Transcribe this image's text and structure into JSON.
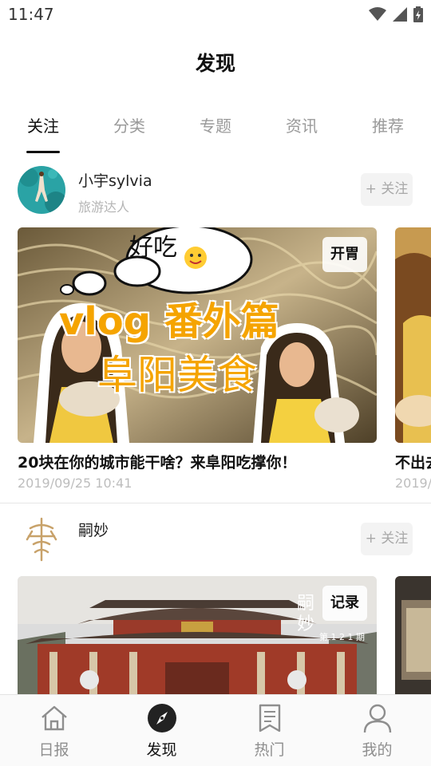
{
  "status_bar": {
    "time": "11:47"
  },
  "header": {
    "title": "发现"
  },
  "tabs": [
    {
      "label": "关注",
      "active": true
    },
    {
      "label": "分类",
      "active": false
    },
    {
      "label": "专题",
      "active": false
    },
    {
      "label": "资讯",
      "active": false
    },
    {
      "label": "推荐",
      "active": false
    }
  ],
  "feed": [
    {
      "author": {
        "name": "小宇sylvia",
        "subtitle": "旅游达人",
        "follow_label": "+ 关注"
      },
      "card": {
        "tag": "开胃",
        "title": "20块在你的城市能干啥？来阜阳吃撑你！",
        "time": "2019/09/25 10:41",
        "overlay_bubble": "好吃",
        "overlay_line1": "vlog 番外篇",
        "overlay_line2": "阜阳美食"
      },
      "peek": {
        "title": "不出去",
        "time": "2019/"
      }
    },
    {
      "author": {
        "name": "嗣妙",
        "subtitle": "",
        "follow_label": "+ 关注"
      },
      "card": {
        "tag": "记录",
        "watermark": "嗣妙",
        "watermark_sub": "第 1 2 1 期"
      }
    }
  ],
  "bottom_nav": [
    {
      "label": "日报",
      "icon": "home-icon",
      "active": false
    },
    {
      "label": "发现",
      "icon": "compass-icon",
      "active": true
    },
    {
      "label": "热门",
      "icon": "bookmark-icon",
      "active": false
    },
    {
      "label": "我的",
      "icon": "person-icon",
      "active": false
    }
  ],
  "colors": {
    "accent": "#111111",
    "muted": "#9a9a9a",
    "follow_bg": "#f3f3f3",
    "overlay_text": "#f5a400"
  }
}
